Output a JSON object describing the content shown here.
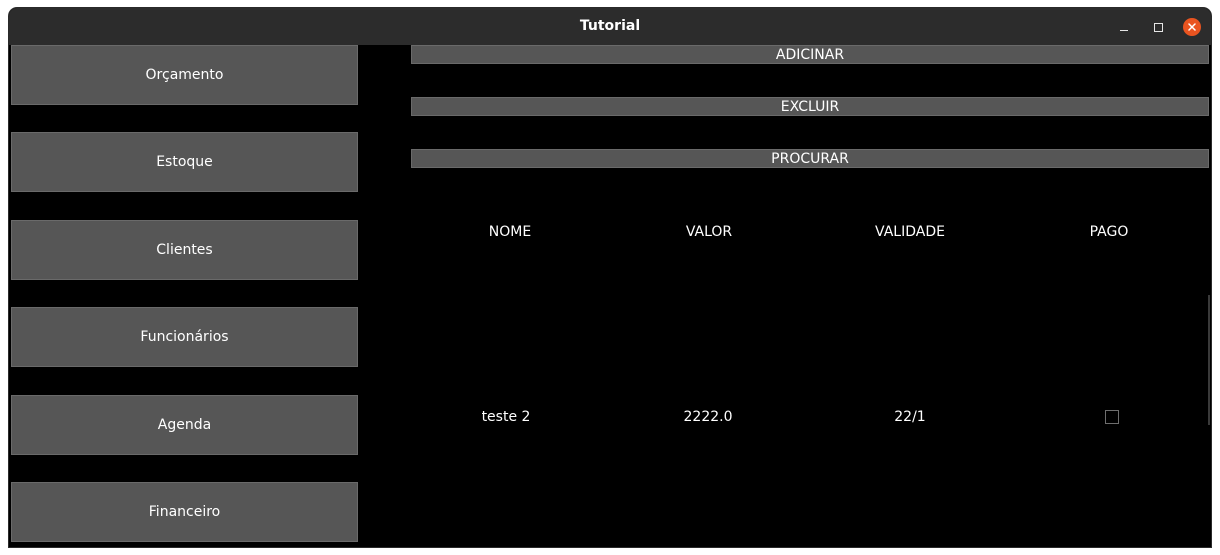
{
  "window": {
    "title": "Tutorial"
  },
  "sidebar": {
    "items": [
      {
        "label": "Orçamento"
      },
      {
        "label": "Estoque"
      },
      {
        "label": "Clientes"
      },
      {
        "label": "Funcionários"
      },
      {
        "label": "Agenda"
      },
      {
        "label": "Financeiro"
      }
    ]
  },
  "actions": {
    "add_label": "ADICINAR",
    "delete_label": "EXCLUIR",
    "search_label": "PROCURAR"
  },
  "table": {
    "columns": [
      "NOME",
      "VALOR",
      "VALIDADE",
      "PAGO"
    ],
    "rows": [
      {
        "nome": "teste 2",
        "valor": "2222.0",
        "validade": "22/1",
        "pago": false
      }
    ]
  },
  "colors": {
    "button_bg": "#565656",
    "background": "#000000",
    "titlebar": "#2c2c2c",
    "close_button": "#e95420"
  }
}
